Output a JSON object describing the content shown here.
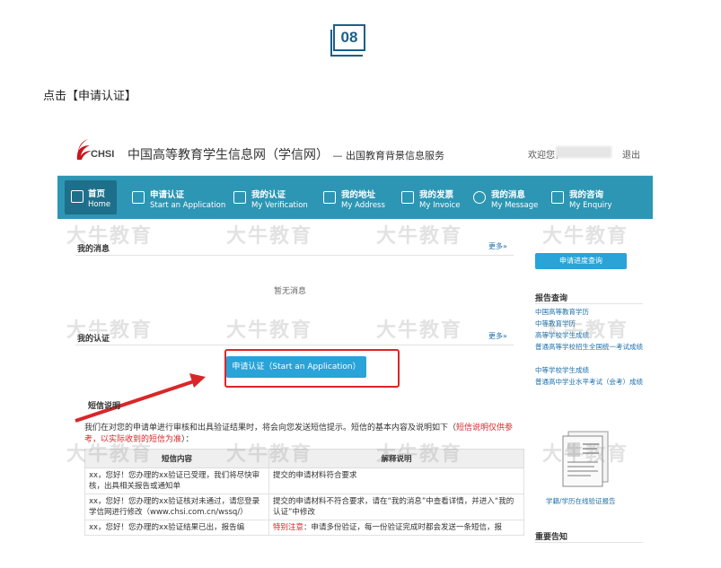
{
  "step": "08",
  "instruction": "点击【申请认证】",
  "header": {
    "logo_text": "CHSI",
    "site_title": "中国高等教育学生信息网（学信网）",
    "site_sub": "— 出国教育背景信息服务",
    "welcome": "欢迎您，",
    "logout": "退出"
  },
  "nav": [
    {
      "cn": "首页",
      "en": "Home"
    },
    {
      "cn": "申请认证",
      "en": "Start an Application"
    },
    {
      "cn": "我的认证",
      "en": "My Verification"
    },
    {
      "cn": "我的地址",
      "en": "My Address"
    },
    {
      "cn": "我的发票",
      "en": "My Invoice"
    },
    {
      "cn": "我的消息",
      "en": "My Message"
    },
    {
      "cn": "我的咨询",
      "en": "My Enquiry"
    }
  ],
  "main": {
    "messages_title": "我的消息",
    "more": "更多»",
    "no_messages": "暂无消息",
    "verification_title": "我的认证",
    "apply_button": "申请认证（Start an Application）",
    "sms_title": "短信说明",
    "sms_desc_1": "我们在对您的申请单进行审核和出具验证结果时，将会向您发送短信提示。短信的基本内容及说明如下（",
    "sms_desc_red": "短信说明仅供参考，以实际收到的短信为准",
    "sms_desc_2": "）：",
    "table_headers": [
      "短信内容",
      "解释说明"
    ],
    "table_rows": [
      [
        "xx，您好！您办理的xx验证已受理，我们将尽快审核，出具相关报告或通知单",
        "提交的申请材料符合要求"
      ],
      [
        "xx，您好！您办理的xx验证核对未通过，请您登录学信网进行修改（www.chsi.com.cn/wssq/）",
        "提交的申请材料不符合要求，请在“我的消息”中查看详情，并进入“我的认证”中修改"
      ],
      [
        "xx，您好！您办理的xx验证结果已出，报告编",
        "特别注意：申请多份验证，每一份验证完成时都会发送一条短信，报"
      ]
    ]
  },
  "sidebar": {
    "progress_button": "申请进度查询",
    "report_title": "报告查询",
    "links": [
      "中国高等教育学历",
      "中等教育学历",
      "高等学校学生成绩",
      "普通高等学校招生全国统一考试成绩",
      "中等学校学生成绩",
      "普通高中学业水平考试（会考）成绩"
    ],
    "cert_caption": "学籍/学历在线验证报告",
    "notice_title": "重要告知",
    "notice_text": "…"
  },
  "watermark": "大牛教育",
  "colors": {
    "nav_bg": "#2d96b4",
    "button_bg": "#29a3d8",
    "highlight_red": "#d9262a",
    "link_blue": "#1a6ea8"
  }
}
